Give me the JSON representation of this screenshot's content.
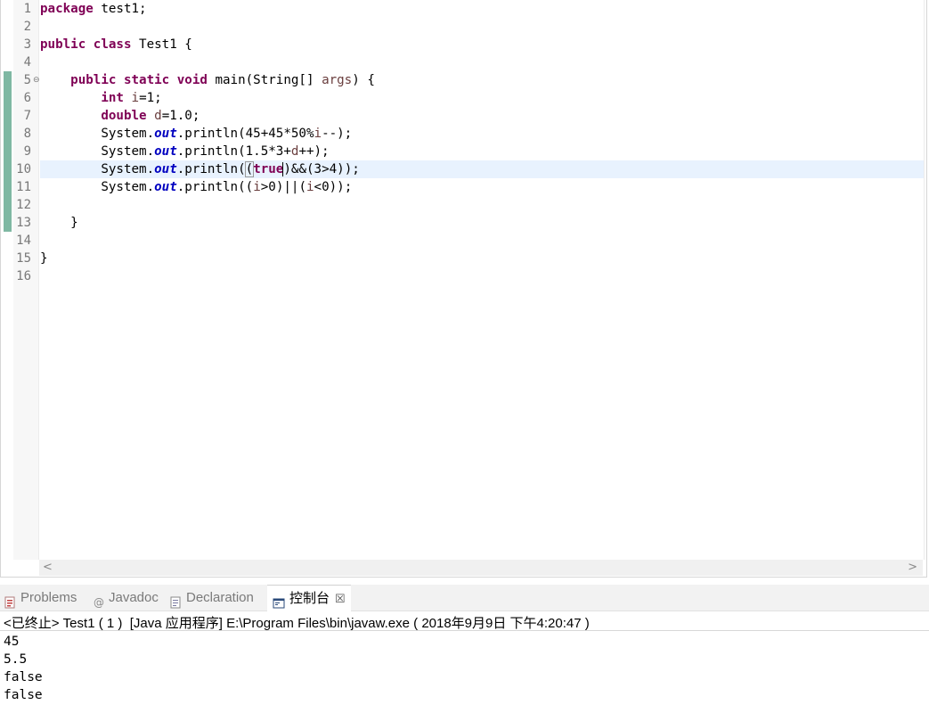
{
  "editor": {
    "line_numbers": [
      "1",
      "2",
      "3",
      "4",
      "5",
      "6",
      "7",
      "8",
      "9",
      "10",
      "11",
      "12",
      "13",
      "14",
      "15",
      "16"
    ],
    "lines": {
      "l1": {
        "kw": "package",
        "rest": " test1;"
      },
      "l3": {
        "kw1": "public",
        "kw2": "class",
        "rest": " Test1 {"
      },
      "l5": {
        "indent": "    ",
        "kw1": "public",
        "kw2": "static",
        "kw3": "void",
        "rest": " main(String[] ",
        "var": "args",
        "end": ") {"
      },
      "l6": {
        "indent": "        ",
        "kw": "int",
        "var": "i",
        "rest": "=1;"
      },
      "l7": {
        "indent": "        ",
        "kw": "double",
        "var": "d",
        "rest": "=1.0;"
      },
      "l8": {
        "indent": "        ",
        "pre": "System.",
        "fld": "out",
        "mid": ".println(45+45*50%",
        "var": "i",
        "end": "--);"
      },
      "l9": {
        "indent": "        ",
        "pre": "System.",
        "fld": "out",
        "mid": ".println(1.5*3+",
        "var": "d",
        "end": "++);"
      },
      "l10": {
        "indent": "        ",
        "pre": "System.",
        "fld": "out",
        "mid": ".println(",
        "open": "(",
        "kw": "true",
        "close": ")",
        "end": "&&(3>4));"
      },
      "l11": {
        "indent": "        ",
        "pre": "System.",
        "fld": "out",
        "mid": ".println((",
        "var1": "i",
        "m2": ">0)||(",
        "var2": "i",
        "end": "<0));"
      },
      "l13": {
        "text": "    }"
      },
      "l15": {
        "text": "}"
      }
    },
    "fold_icon": "collapse-icon",
    "scroll_left": "<",
    "scroll_right": ">"
  },
  "panel": {
    "tabs": [
      {
        "label": "Problems",
        "icon": "problems-icon"
      },
      {
        "label": "Javadoc",
        "icon": "javadoc-icon"
      },
      {
        "label": "Declaration",
        "icon": "declaration-icon"
      },
      {
        "label": "控制台",
        "icon": "console-icon"
      }
    ],
    "close_glyph": "☒",
    "console_header": "<已终止> Test1 ( 1 )  [Java 应用程序] E:\\Program Files\\bin\\javaw.exe ( 2018年9月9日 下午4:20:47 )",
    "output": [
      "45",
      "5.5",
      "false",
      "false"
    ]
  },
  "colors": {
    "keyword": "#7f0055",
    "variable": "#6a3e3e",
    "field": "#0000c0",
    "current_line": "#e8f2fe",
    "change_bar": "#7fb8a3"
  }
}
